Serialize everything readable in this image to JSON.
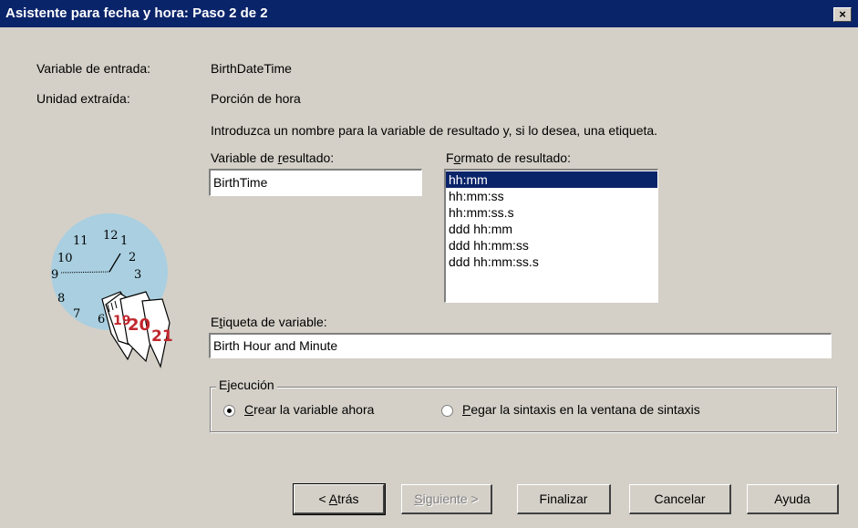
{
  "window": {
    "title": "Asistente para fecha y hora: Paso 2 de 2",
    "close_symbol": "×"
  },
  "info": {
    "input_label": "Variable de entrada:",
    "input_value": "BirthDateTime",
    "unit_label": "Unidad extraída:",
    "unit_value": "Porción de hora",
    "instructions": "Introduzca un nombre para la variable de resultado y, si lo desea, una etiqueta."
  },
  "result_var": {
    "label_pre": "Variable de ",
    "label_accel": "r",
    "label_post": "esultado:",
    "value": "BirthTime"
  },
  "format": {
    "label_pre": "F",
    "label_accel": "o",
    "label_post": "rmato de resultado:",
    "options": [
      "hh:mm",
      "hh:mm:ss",
      "hh:mm:ss.s",
      "ddd hh:mm",
      "ddd hh:mm:ss",
      "ddd hh:mm:ss.s"
    ],
    "selected": "hh:mm"
  },
  "var_label": {
    "label_pre": "E",
    "label_accel": "t",
    "label_post": "iqueta de variable:",
    "value": "Birth Hour and Minute"
  },
  "execution": {
    "legend": "Ejecución",
    "opt1_accel": "C",
    "opt1_rest": "rear la variable ahora",
    "opt2_accel": "P",
    "opt2_rest": "egar la sintaxis en la ventana de sintaxis",
    "selected": "opt1"
  },
  "clock": {
    "numbers": [
      "12",
      "1",
      "2",
      "3",
      "11",
      "10",
      "9",
      "8",
      "7",
      "6"
    ],
    "calendar_pages": [
      "19",
      "20",
      "21"
    ]
  },
  "buttons": {
    "back_pre": "< ",
    "back_accel": "A",
    "back_post": "trás",
    "next_accel": "S",
    "next_post": "iguiente >",
    "finish": "Finalizar",
    "cancel": "Cancelar",
    "help": "Ayuda"
  },
  "colors": {
    "title_bg": "#0a246a",
    "selection_bg": "#0a246a",
    "dialog_bg": "#d4d0c8",
    "clock_face": "#a9cfe0",
    "calendar_red": "#c0272d"
  }
}
